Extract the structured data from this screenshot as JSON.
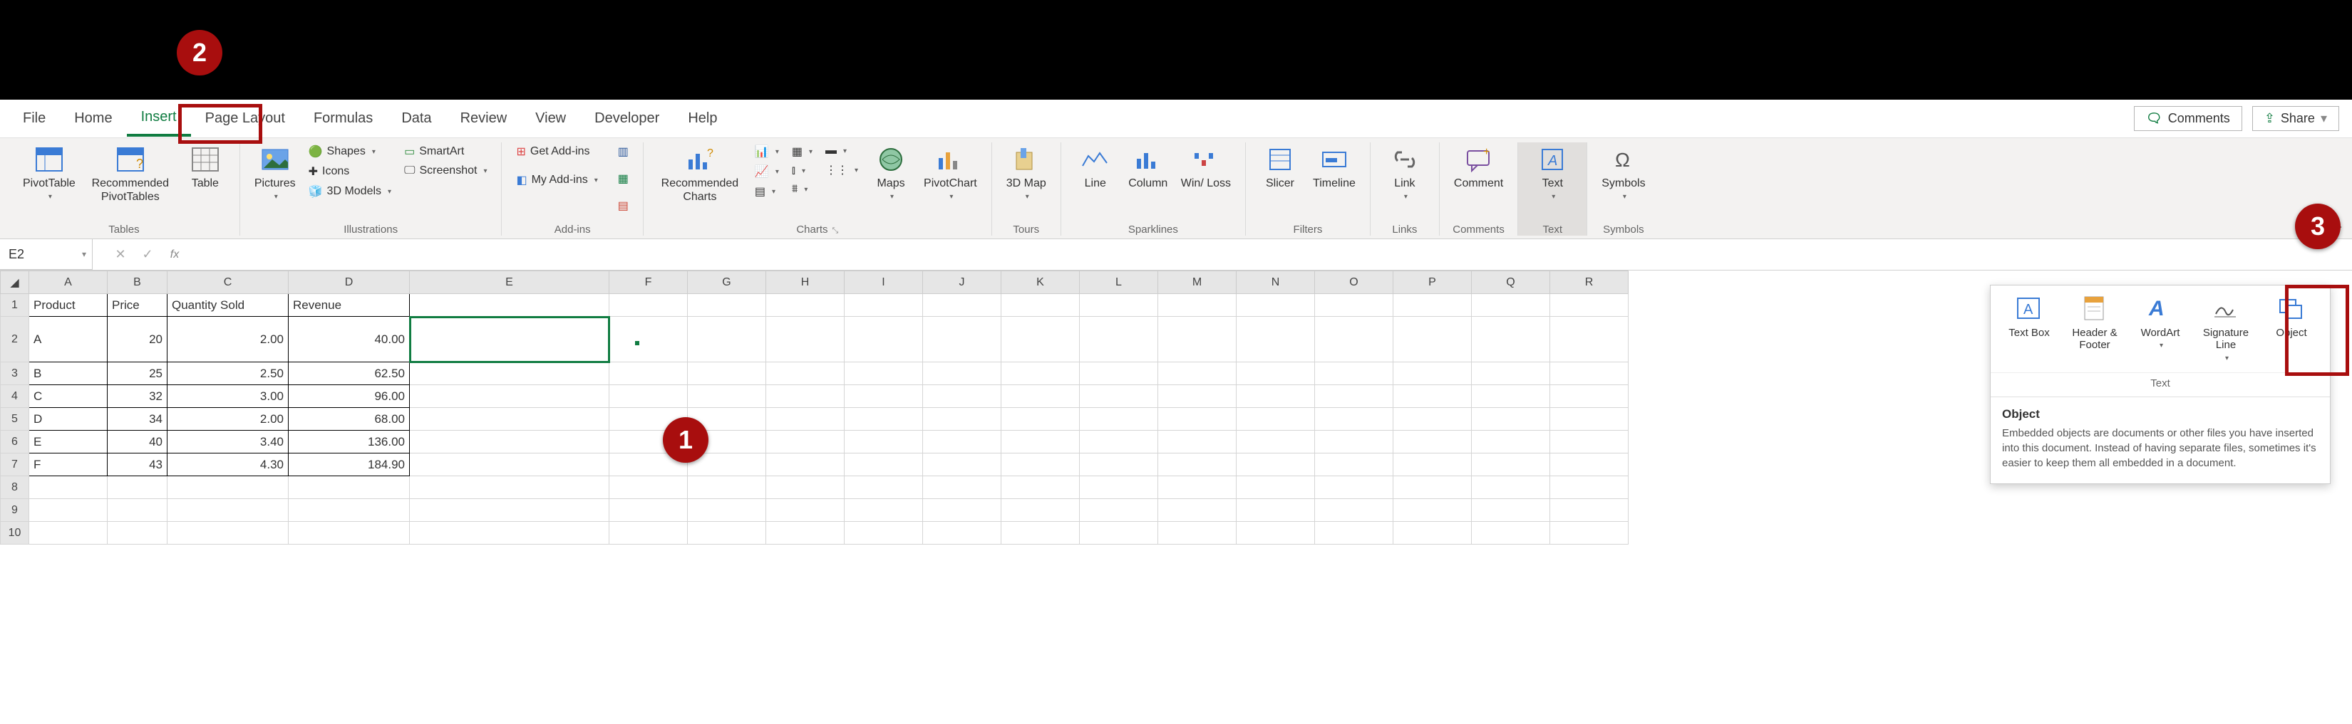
{
  "tabs": {
    "file": "File",
    "home": "Home",
    "insert": "Insert",
    "pageLayout": "Page Layout",
    "formulas": "Formulas",
    "data": "Data",
    "review": "Review",
    "view": "View",
    "developer": "Developer",
    "help": "Help"
  },
  "tabRight": {
    "comments": "Comments",
    "share": "Share"
  },
  "ribbon": {
    "tables": {
      "pivotTable": "PivotTable",
      "recommended": "Recommended PivotTables",
      "table": "Table",
      "label": "Tables"
    },
    "illustrations": {
      "pictures": "Pictures",
      "shapes": "Shapes",
      "icons": "Icons",
      "models": "3D Models",
      "smartart": "SmartArt",
      "screenshot": "Screenshot",
      "label": "Illustrations"
    },
    "addins": {
      "get": "Get Add-ins",
      "my": "My Add-ins",
      "label": "Add-ins"
    },
    "charts": {
      "recommended": "Recommended Charts",
      "maps": "Maps",
      "pivotChart": "PivotChart",
      "label": "Charts"
    },
    "tours": {
      "map3d": "3D Map",
      "label": "Tours"
    },
    "sparklines": {
      "line": "Line",
      "column": "Column",
      "winloss": "Win/ Loss",
      "label": "Sparklines"
    },
    "filters": {
      "slicer": "Slicer",
      "timeline": "Timeline",
      "label": "Filters"
    },
    "links": {
      "link": "Link",
      "label": "Links"
    },
    "comments": {
      "comment": "Comment",
      "label": "Comments"
    },
    "text": {
      "text": "Text",
      "label": "Text"
    },
    "symbols": {
      "symbols": "Symbols",
      "label": "Symbols"
    }
  },
  "formulaBar": {
    "nameBox": "E2"
  },
  "columns": [
    "A",
    "B",
    "C",
    "D",
    "E",
    "F",
    "G",
    "H",
    "I",
    "J",
    "K",
    "L",
    "M",
    "N",
    "O",
    "P",
    "Q",
    "R"
  ],
  "headers": {
    "product": "Product",
    "price": "Price",
    "qty": "Quantity Sold",
    "revenue": "Revenue"
  },
  "rows": [
    {
      "n": "2",
      "p": "A",
      "price": "20",
      "qty": "2.00",
      "rev": "40.00"
    },
    {
      "n": "3",
      "p": "B",
      "price": "25",
      "qty": "2.50",
      "rev": "62.50"
    },
    {
      "n": "4",
      "p": "C",
      "price": "32",
      "qty": "3.00",
      "rev": "96.00"
    },
    {
      "n": "5",
      "p": "D",
      "price": "34",
      "qty": "2.00",
      "rev": "68.00"
    },
    {
      "n": "6",
      "p": "E",
      "price": "40",
      "qty": "3.40",
      "rev": "136.00"
    },
    {
      "n": "7",
      "p": "F",
      "price": "43",
      "qty": "4.30",
      "rev": "184.90"
    }
  ],
  "emptyRows": [
    "8",
    "9",
    "10"
  ],
  "popup": {
    "textbox": "Text Box",
    "header": "Header & Footer",
    "wordart": "WordArt",
    "sigline": "Signature Line",
    "object": "Object",
    "groupLabel": "Text",
    "tooltipTitle": "Object",
    "tooltipBody": "Embedded objects are documents or other files you have inserted into this document. Instead of having separate files, sometimes it's easier to keep them all embedded in a document."
  },
  "callouts": {
    "one": "1",
    "two": "2",
    "three": "3"
  },
  "chart_data": {
    "type": "table",
    "title": "Product revenue table",
    "columns": [
      "Product",
      "Price",
      "Quantity Sold",
      "Revenue"
    ],
    "rows": [
      [
        "A",
        20,
        2.0,
        40.0
      ],
      [
        "B",
        25,
        2.5,
        62.5
      ],
      [
        "C",
        32,
        3.0,
        96.0
      ],
      [
        "D",
        34,
        2.0,
        68.0
      ],
      [
        "E",
        40,
        3.4,
        136.0
      ],
      [
        "F",
        43,
        4.3,
        184.9
      ]
    ]
  }
}
